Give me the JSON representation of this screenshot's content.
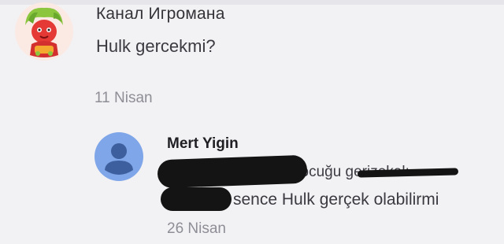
{
  "main_comment": {
    "author": "Канал Игромана",
    "text": "Hulk gercekmi?",
    "date": "11 Nisan",
    "avatar_icon": "game-character-avatar-icon"
  },
  "reply": {
    "author": "Mert Yigin",
    "line1_visible": "çocuğu gerizekalı",
    "line2_visible": "sence Hulk gerçek olabilirmi",
    "date": "26 Nisan",
    "avatar_icon": "default-user-avatar-icon",
    "avatar_color": "#7fa6e8"
  }
}
